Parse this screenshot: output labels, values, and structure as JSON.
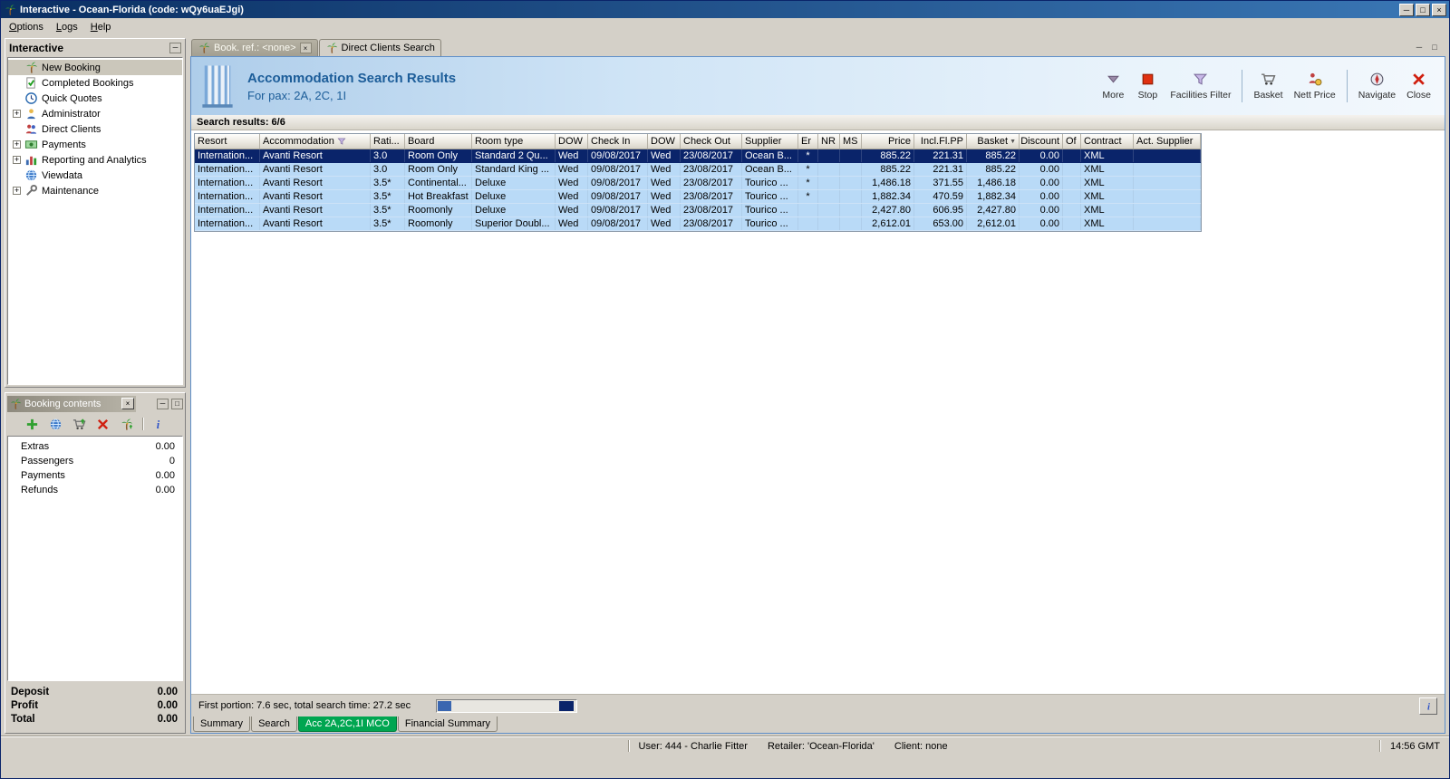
{
  "window": {
    "title": "Interactive - Ocean-Florida (code: wQy6uaEJgi)",
    "controls": [
      "minimize",
      "maximize",
      "close"
    ]
  },
  "menubar": {
    "items": [
      {
        "label": "Options"
      },
      {
        "label": "Logs"
      },
      {
        "label": "Help"
      }
    ]
  },
  "sidebar": {
    "title": "Interactive",
    "items": [
      {
        "label": "New Booking",
        "icon": "palm",
        "expandable": false,
        "selected": true
      },
      {
        "label": "Completed Bookings",
        "icon": "check",
        "expandable": false
      },
      {
        "label": "Quick Quotes",
        "icon": "clock",
        "expandable": false
      },
      {
        "label": "Administrator",
        "icon": "person",
        "expandable": true
      },
      {
        "label": "Direct Clients",
        "icon": "people",
        "expandable": false
      },
      {
        "label": "Payments",
        "icon": "money",
        "expandable": true
      },
      {
        "label": "Reporting and Analytics",
        "icon": "chart",
        "expandable": true
      },
      {
        "label": "Viewdata",
        "icon": "globe",
        "expandable": false
      },
      {
        "label": "Maintenance",
        "icon": "tools",
        "expandable": true
      }
    ]
  },
  "booking_contents": {
    "title": "Booking contents",
    "toolbar": [
      {
        "icon": "add"
      },
      {
        "icon": "globe"
      },
      {
        "icon": "basket-add"
      },
      {
        "icon": "delete"
      },
      {
        "icon": "palm-up"
      },
      {
        "sep": true
      },
      {
        "icon": "info"
      }
    ],
    "rows": [
      {
        "label": "Extras",
        "value": "0.00"
      },
      {
        "label": "Passengers",
        "value": "0"
      },
      {
        "label": "Payments",
        "value": "0.00"
      },
      {
        "label": "Refunds",
        "value": "0.00"
      }
    ],
    "totals": [
      {
        "label": "Deposit",
        "value": "0.00"
      },
      {
        "label": "Profit",
        "value": "0.00"
      },
      {
        "label": "Total",
        "value": "0.00"
      }
    ]
  },
  "tabs": [
    {
      "label": "Book. ref.: <none>",
      "icon": "palm",
      "active": true,
      "closable": true
    },
    {
      "label": "Direct Clients Search",
      "icon": "palm",
      "active": false,
      "closable": false
    }
  ],
  "banner": {
    "title": "Accommodation Search Results",
    "subtitle": "For pax: 2A, 2C, 1I"
  },
  "banner_toolbar": [
    {
      "label": "More",
      "icon": "more"
    },
    {
      "label": "Stop",
      "icon": "stop"
    },
    {
      "label": "Facilities Filter",
      "icon": "funnel",
      "sep_after": true
    },
    {
      "label": "Basket",
      "icon": "cart"
    },
    {
      "label": "Nett Price",
      "icon": "nett",
      "sep_after": true
    },
    {
      "label": "Navigate",
      "icon": "navigate"
    },
    {
      "label": "Close",
      "icon": "close"
    }
  ],
  "results": {
    "summary": "Search results: 6/6",
    "columns": [
      {
        "label": "Resort"
      },
      {
        "label": "Accommodation",
        "filter": true
      },
      {
        "label": "Rati..."
      },
      {
        "label": "Board"
      },
      {
        "label": "Room type"
      },
      {
        "label": "DOW"
      },
      {
        "label": "Check In"
      },
      {
        "label": "DOW"
      },
      {
        "label": "Check Out"
      },
      {
        "label": "Supplier"
      },
      {
        "label": "Er"
      },
      {
        "label": "NR"
      },
      {
        "label": "MS"
      },
      {
        "label": "Price"
      },
      {
        "label": "Incl.Fl.PP"
      },
      {
        "label": "Basket",
        "sort": "desc"
      },
      {
        "label": "Discount"
      },
      {
        "label": "Of"
      },
      {
        "label": "Contract"
      },
      {
        "label": "Act. Supplier"
      }
    ],
    "rows": [
      {
        "selected": true,
        "cells": [
          "Internation...",
          "Avanti Resort",
          "3.0",
          "Room Only",
          "Standard 2 Qu...",
          "Wed",
          "09/08/2017",
          "Wed",
          "23/08/2017",
          "Ocean B...",
          "*",
          "",
          "",
          "885.22",
          "221.31",
          "885.22",
          "0.00",
          "",
          "XML",
          ""
        ]
      },
      {
        "selected": false,
        "cells": [
          "Internation...",
          "Avanti Resort",
          "3.0",
          "Room Only",
          "Standard King ...",
          "Wed",
          "09/08/2017",
          "Wed",
          "23/08/2017",
          "Ocean B...",
          "*",
          "",
          "",
          "885.22",
          "221.31",
          "885.22",
          "0.00",
          "",
          "XML",
          ""
        ]
      },
      {
        "selected": false,
        "cells": [
          "Internation...",
          "Avanti Resort",
          "3.5*",
          "Continental...",
          "Deluxe",
          "Wed",
          "09/08/2017",
          "Wed",
          "23/08/2017",
          "Tourico ...",
          "*",
          "",
          "",
          "1,486.18",
          "371.55",
          "1,486.18",
          "0.00",
          "",
          "XML",
          ""
        ]
      },
      {
        "selected": false,
        "cells": [
          "Internation...",
          "Avanti Resort",
          "3.5*",
          "Hot Breakfast",
          "Deluxe",
          "Wed",
          "09/08/2017",
          "Wed",
          "23/08/2017",
          "Tourico ...",
          "*",
          "",
          "",
          "1,882.34",
          "470.59",
          "1,882.34",
          "0.00",
          "",
          "XML",
          ""
        ]
      },
      {
        "selected": false,
        "cells": [
          "Internation...",
          "Avanti Resort",
          "3.5*",
          "Roomonly",
          "Deluxe",
          "Wed",
          "09/08/2017",
          "Wed",
          "23/08/2017",
          "Tourico ...",
          "",
          "",
          "",
          "2,427.80",
          "606.95",
          "2,427.80",
          "0.00",
          "",
          "XML",
          ""
        ]
      },
      {
        "selected": false,
        "cells": [
          "Internation...",
          "Avanti Resort",
          "3.5*",
          "Roomonly",
          "Superior Doubl...",
          "Wed",
          "09/08/2017",
          "Wed",
          "23/08/2017",
          "Tourico ...",
          "",
          "",
          "",
          "2,612.01",
          "653.00",
          "2,612.01",
          "0.00",
          "",
          "XML",
          ""
        ]
      }
    ]
  },
  "status_row": {
    "text": "First portion: 7.6 sec, total search time: 27.2 sec"
  },
  "bottom_tabs": [
    {
      "label": "Summary",
      "active": false
    },
    {
      "label": "Search",
      "active": false
    },
    {
      "label": "Acc 2A,2C,1I MCO",
      "active": true
    },
    {
      "label": "Financial Summary",
      "active": false
    }
  ],
  "statusbar": {
    "user": "User: 444 - Charlie Fitter",
    "retailer": "Retailer: 'Ocean-Florida'",
    "client": "Client: none",
    "time": "14:56 GMT"
  },
  "colors": {
    "titlebar_start": "#0a2f63",
    "titlebar_end": "#3a77b5",
    "selected_row": "#0a246a",
    "result_row": "#b9daf7",
    "active_tab_green": "#00a651",
    "banner_blue": "#aecdea",
    "banner_text": "#1c5d99"
  }
}
